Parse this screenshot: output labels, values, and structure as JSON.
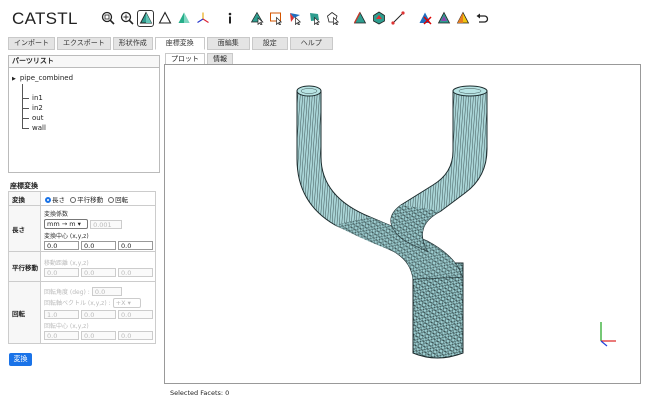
{
  "app": {
    "title": "CATSTL"
  },
  "toolbar": {
    "buttons": [
      {
        "name": "zoom-fit-icon"
      },
      {
        "name": "zoom-selection-icon"
      },
      {
        "name": "shaded-view-icon",
        "selected": true
      },
      {
        "name": "wireframe-view-icon"
      },
      {
        "name": "shape-color-icon"
      },
      {
        "name": "axis-icon"
      },
      {
        "name": "info-icon"
      },
      {
        "name": "select-facet-icon"
      },
      {
        "name": "select-region-icon"
      },
      {
        "name": "select-flag-icon"
      },
      {
        "name": "select-shape-icon"
      },
      {
        "name": "select-wire-icon"
      },
      {
        "name": "select-edge-icon"
      },
      {
        "name": "select-patch-icon"
      },
      {
        "name": "measure-icon"
      },
      {
        "name": "delete-facet-icon"
      },
      {
        "name": "flip-normal-icon"
      },
      {
        "name": "color-facet-icon"
      },
      {
        "name": "undo-icon"
      }
    ]
  },
  "menu_tabs": [
    {
      "label": "インポート",
      "active": false
    },
    {
      "label": "エクスポート",
      "active": false
    },
    {
      "label": "形状作成",
      "active": false
    },
    {
      "label": "座標変換",
      "active": true
    },
    {
      "label": "面編集",
      "active": false
    },
    {
      "label": "設定",
      "active": false
    },
    {
      "label": "ヘルプ",
      "active": false
    }
  ],
  "parts_list": {
    "header": "パーツリスト",
    "root": "pipe_combined",
    "children": [
      "in1",
      "in2",
      "out",
      "wall"
    ]
  },
  "transform": {
    "title": "座標変換",
    "mode_label": "変換",
    "modes": [
      {
        "label": "長さ",
        "checked": true
      },
      {
        "label": "平行移動",
        "checked": false
      },
      {
        "label": "回転",
        "checked": false
      }
    ],
    "length": {
      "label": "長さ",
      "factor_label": "変換係数",
      "unit_select": "mm → m",
      "factor_value": "0.001",
      "center_label": "変換中心 (x,y,z)",
      "center": [
        "0.0",
        "0.0",
        "0.0"
      ]
    },
    "translate": {
      "label": "平行移動",
      "distance_label": "移動距離 (x,y,z)",
      "values": [
        "0.0",
        "0.0",
        "0.0"
      ]
    },
    "rotate": {
      "label": "回転",
      "angle_label": "回転角度 (deg) :",
      "angle_value": "0.0",
      "axis_label": "回転軸ベクトル (x,y,z) :",
      "axis_select": "+X",
      "axis_values": [
        "1.0",
        "0.0",
        "0.0"
      ],
      "center_label": "回転中心 (x,y,z)",
      "center": [
        "0.0",
        "0.0",
        "0.0"
      ]
    },
    "apply": "変換"
  },
  "plot_tabs": [
    {
      "label": "プロット",
      "active": true
    },
    {
      "label": "情報",
      "active": false
    }
  ],
  "status": {
    "text": "Selected Facets: 0"
  },
  "colors": {
    "accent": "#1a73e8",
    "mesh": "#a9d4d6",
    "mesh_edge": "#1c2b2d"
  }
}
